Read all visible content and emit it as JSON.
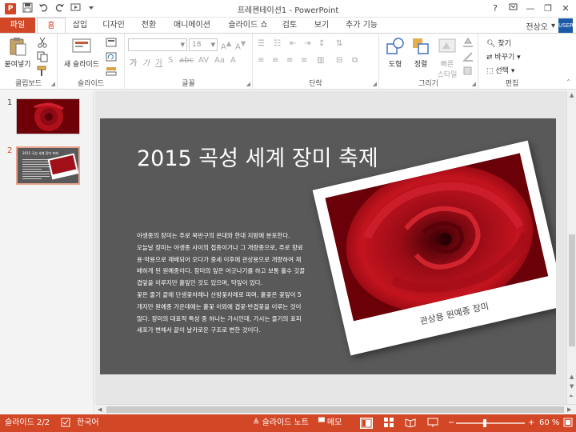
{
  "window": {
    "title": "프레젠테이션1 - PowerPoint",
    "app_icon": "P",
    "help": "?",
    "minimize": "—",
    "restore": "❐",
    "close": "✕"
  },
  "qat": [
    "save-icon",
    "undo-icon",
    "redo-icon",
    "start-slideshow-icon",
    "customize-qat-icon"
  ],
  "tabs": [
    {
      "label": "파일",
      "name": "file"
    },
    {
      "label": "홈",
      "name": "home"
    },
    {
      "label": "삽입",
      "name": "insert"
    },
    {
      "label": "디자인",
      "name": "design"
    },
    {
      "label": "전환",
      "name": "transitions"
    },
    {
      "label": "애니메이션",
      "name": "animations"
    },
    {
      "label": "슬라이드 쇼",
      "name": "slideshow"
    },
    {
      "label": "검토",
      "name": "review"
    },
    {
      "label": "보기",
      "name": "view"
    },
    {
      "label": "추가 기능",
      "name": "addins"
    }
  ],
  "user": {
    "name": "전상오",
    "avatar": "USER"
  },
  "ribbon": {
    "clipboard": {
      "label": "클립보드",
      "paste": "붙여넣기"
    },
    "slides": {
      "label": "슬라이드",
      "new_slide": "새 슬라이드"
    },
    "font": {
      "label": "글꼴",
      "font_size": "18",
      "font_name": ""
    },
    "paragraph": {
      "label": "단락"
    },
    "drawing": {
      "label": "그리기",
      "shapes": "도형",
      "arrange": "정렬",
      "quick_styles_1": "빠른",
      "quick_styles_2": "스타일"
    },
    "editing": {
      "label": "편집",
      "find": "찾기",
      "replace": "바꾸기",
      "select": "선택"
    }
  },
  "thumbnails": [
    {
      "number": "1"
    },
    {
      "number": "2",
      "mini_title": "2015 곡성 세계 장미 축제"
    }
  ],
  "slide": {
    "title": "2015 곡성 세계 장미 축제",
    "body": [
      "야생종의 장미는 주로 북반구의 온대와 한대 지방에 분포한다.",
      "오늘날 장미는 야생종 사이의 접종이거나 그 개량종으로, 주로 향료",
      "용·약용으로 재배되어 오다가 중세 이후에 관상용으로 개량하여 재",
      "배하게 된 원예종이다. 장미의 잎은 어긋나기를 하고 보통 홀수 깃꼴",
      "겹잎을 이루지만 홑잎인 것도 있으며, 턱잎이 있다.",
      "꽃은 줄기 끝에 단생꽃차례나 산방꽃차례로 피며, 홑꽃은 꽃잎이 5",
      "개지만 원예종 가운데에는 홑꽃 이외에 겹꽃·반겹꽃을 이루는 것이",
      "많다. 장미의 대표적 특성 중 하나는 가시인데, 가시는 줄기의 표피",
      "세포가 변해서 끝이 날카로운 구조로 변한 것이다."
    ],
    "photo_caption": "관상용 원예종 장미"
  },
  "status": {
    "slide_info": "슬라이드 2/2",
    "language": "한국어",
    "notes": "슬라이드 노트",
    "comments": "메모",
    "zoom_minus": "−",
    "zoom_plus": "+",
    "zoom": "60 %"
  },
  "colors": {
    "accent": "#d24726",
    "slide_bg": "#595959",
    "rose": "#b0101a"
  }
}
